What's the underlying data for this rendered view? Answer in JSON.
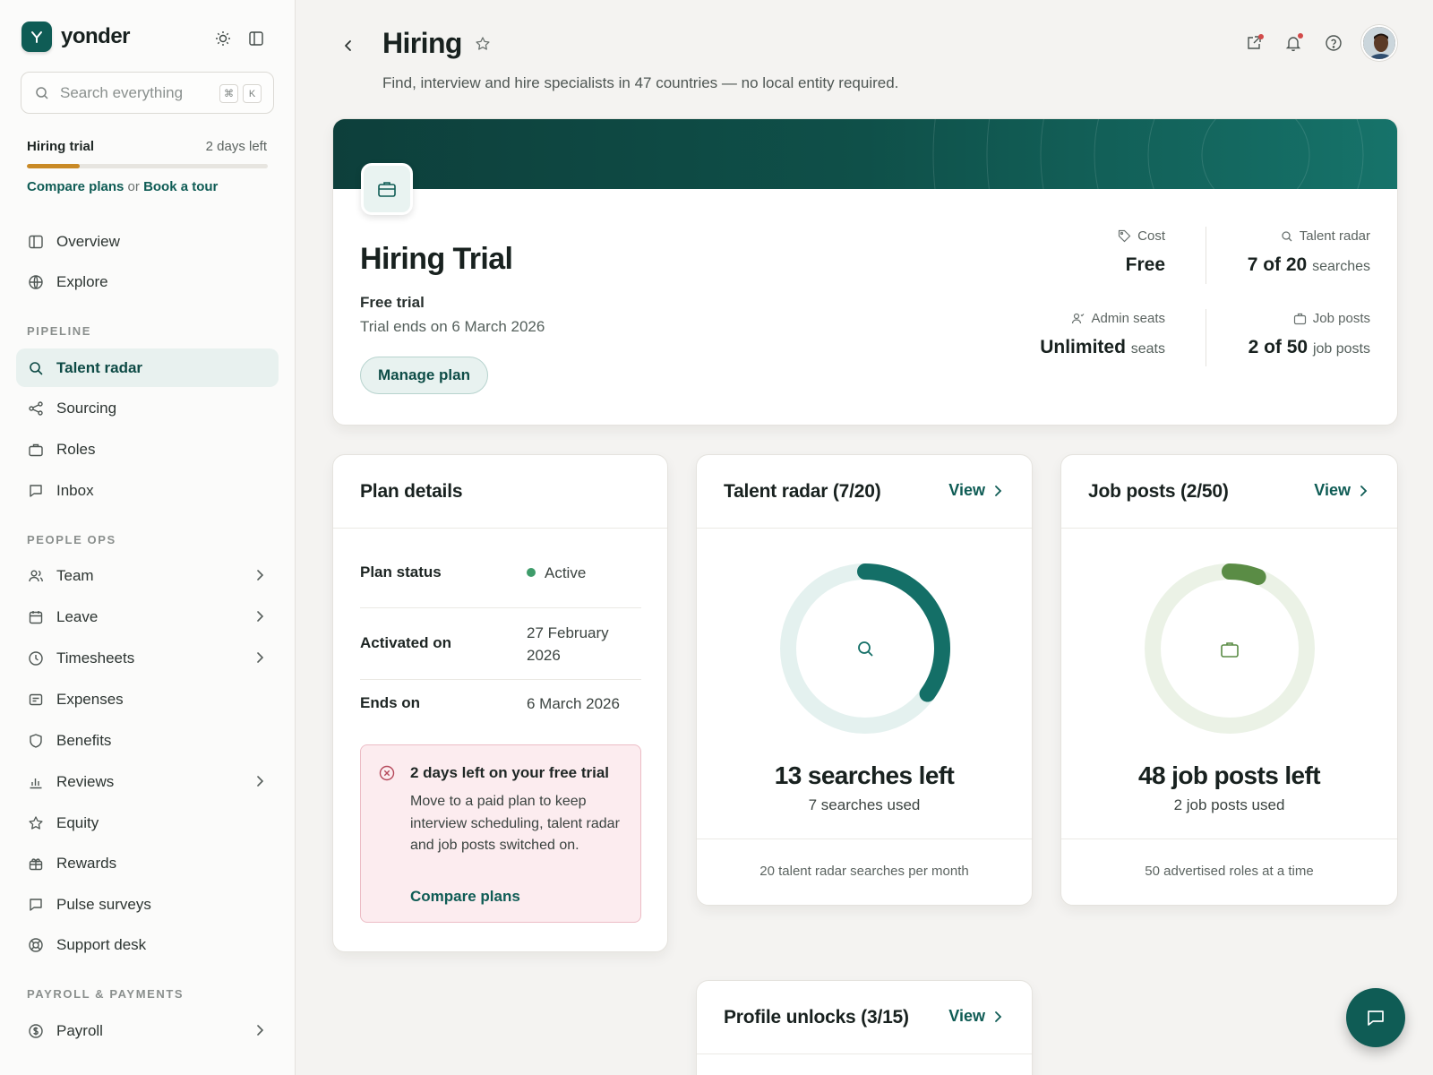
{
  "app": {
    "name": "yonder"
  },
  "sidebar": {
    "search_placeholder": "Search everything",
    "kbd_cmd": "⌘",
    "kbd_key": "K",
    "trial": {
      "label": "Hiring trial",
      "days_left": "2 days left",
      "progress_fraction": 0.22,
      "compare_label": "Compare plans",
      "or_text": "or",
      "tour_label": "Book a tour"
    },
    "main_items": [
      {
        "label": "Overview",
        "icon": "overview-icon"
      },
      {
        "label": "Explore",
        "icon": "globe-icon"
      }
    ],
    "pipeline_label": "PIPELINE",
    "pipeline_items": [
      {
        "label": "Talent radar",
        "icon": "search-icon",
        "active": true
      },
      {
        "label": "Sourcing",
        "icon": "share-icon"
      },
      {
        "label": "Roles",
        "icon": "briefcase-icon"
      },
      {
        "label": "Inbox",
        "icon": "message-icon"
      }
    ],
    "people_ops_label": "PEOPLE OPS",
    "people_ops_items": [
      {
        "label": "Team",
        "icon": "users-icon",
        "expandable": true
      },
      {
        "label": "Leave",
        "icon": "calendar-icon",
        "expandable": true
      },
      {
        "label": "Timesheets",
        "icon": "clock-icon",
        "expandable": true
      },
      {
        "label": "Expenses",
        "icon": "receipt-icon"
      },
      {
        "label": "Benefits",
        "icon": "shield-icon"
      },
      {
        "label": "Reviews",
        "icon": "bar-chart-icon",
        "expandable": true
      },
      {
        "label": "Equity",
        "icon": "star-icon"
      },
      {
        "label": "Rewards",
        "icon": "gift-icon"
      },
      {
        "label": "Pulse surveys",
        "icon": "message-icon"
      },
      {
        "label": "Support desk",
        "icon": "lifebuoy-icon"
      }
    ],
    "payroll_label": "PAYROLL & PAYMENTS",
    "payroll_items": [
      {
        "label": "Payroll",
        "icon": "dollar-icon",
        "expandable": true
      }
    ]
  },
  "header": {
    "title": "Hiring",
    "subtitle": "Find, interview and hire specialists in 47 countries — no local entity required."
  },
  "hero": {
    "title": "Hiring Trial",
    "plan_type": "Free trial",
    "ends_text": "Trial ends on 6 March 2026",
    "manage_label": "Manage plan",
    "stats": {
      "cost": {
        "label": "Cost",
        "value": "Free"
      },
      "talent_radar": {
        "label": "Talent radar",
        "value": "7 of 20",
        "unit": "searches"
      },
      "admin_seats": {
        "label": "Admin seats",
        "value": "Unlimited",
        "unit": "seats"
      },
      "job_posts": {
        "label": "Job posts",
        "value": "2 of 50",
        "unit": "job posts"
      }
    }
  },
  "plan_details": {
    "title": "Plan details",
    "status_label": "Plan status",
    "status_value": "Active",
    "activated_label": "Activated on",
    "activated_value_line1": "27 February",
    "activated_value_line2": "2026",
    "ends_label": "Ends on",
    "ends_value": "6 March 2026",
    "alert": {
      "title": "2 days left on your free trial",
      "body": "Move to a paid plan to keep interview scheduling, talent radar and job posts switched on.",
      "link": "Compare plans"
    }
  },
  "talent_radar_card": {
    "title": "Talent radar (7/20)",
    "view_label": "View",
    "used": 7,
    "total": 20,
    "left_label": "13 searches left",
    "used_label": "7 searches used",
    "footer": "20 talent radar searches per month",
    "color": "#146f67",
    "track_color": "#e4f1ef"
  },
  "job_posts_card": {
    "title": "Job posts (2/50)",
    "view_label": "View",
    "used": 2,
    "total": 50,
    "left_label": "48 job posts left",
    "used_label": "2 job posts used",
    "footer": "50 advertised roles at a time",
    "color": "#5a8c45",
    "track_color": "#ebf2e6"
  },
  "profile_unlocks_card": {
    "title": "Profile unlocks (3/15)",
    "view_label": "View"
  }
}
